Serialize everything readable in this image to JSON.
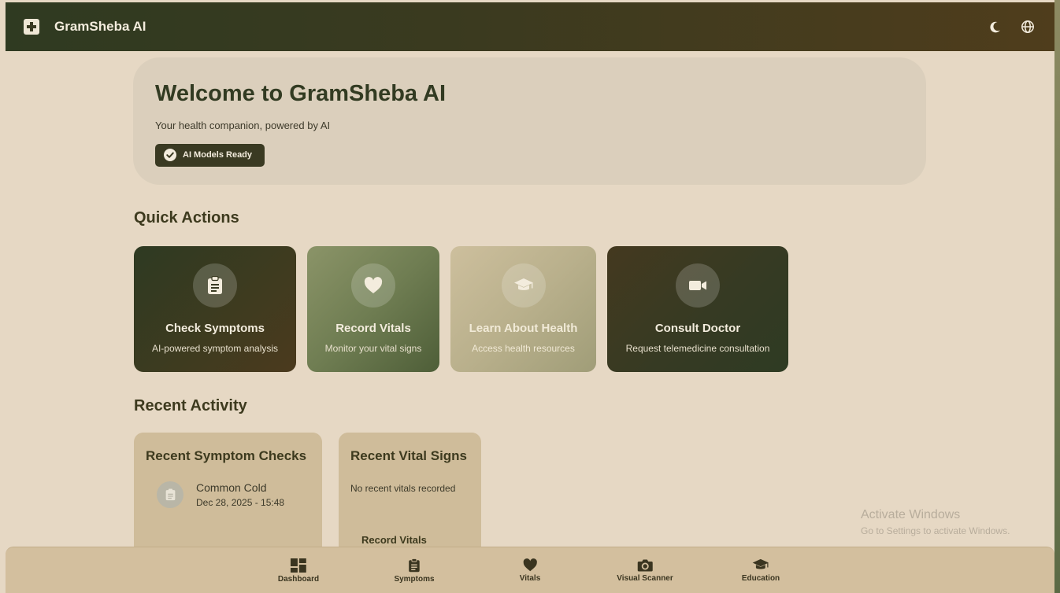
{
  "header": {
    "brand": "GramSheba AI"
  },
  "welcome": {
    "title": "Welcome to GramSheba AI",
    "subtitle": "Your health companion, powered by AI",
    "badge": "AI Models Ready"
  },
  "quick_actions": {
    "title": "Quick Actions",
    "cards": [
      {
        "title": "Check Symptoms",
        "desc": "AI-powered symptom analysis",
        "icon": "clipboard-icon"
      },
      {
        "title": "Record Vitals",
        "desc": "Monitor your vital signs",
        "icon": "heart-icon"
      },
      {
        "title": "Learn About Health",
        "desc": "Access health resources",
        "icon": "graduation-cap-icon"
      },
      {
        "title": "Consult Doctor",
        "desc": "Request telemedicine consultation",
        "icon": "video-camera-icon"
      }
    ]
  },
  "recent_activity": {
    "title": "Recent Activity",
    "symptom_checks": {
      "title": "Recent Symptom Checks",
      "entries": [
        {
          "name": "Common Cold",
          "date": "Dec 28, 2025 - 15:48"
        }
      ]
    },
    "vital_signs": {
      "title": "Recent Vital Signs",
      "empty_text": "No recent vitals recorded",
      "action": "Record Vitals"
    }
  },
  "watermark": {
    "line1": "Activate Windows",
    "line2": "Go to Settings to activate Windows."
  },
  "bottom_nav": [
    {
      "label": "Dashboard",
      "icon": "dashboard-icon"
    },
    {
      "label": "Symptoms",
      "icon": "clipboard-icon"
    },
    {
      "label": "Vitals",
      "icon": "heart-icon"
    },
    {
      "label": "Visual Scanner",
      "icon": "camera-icon"
    },
    {
      "label": "Education",
      "icon": "graduation-cap-icon"
    }
  ],
  "colors": {
    "background": "#e6d8c4",
    "header_dark": "#2f3a21",
    "accent_dark": "#3a3a22",
    "card_tan": "#cfbc9a"
  }
}
